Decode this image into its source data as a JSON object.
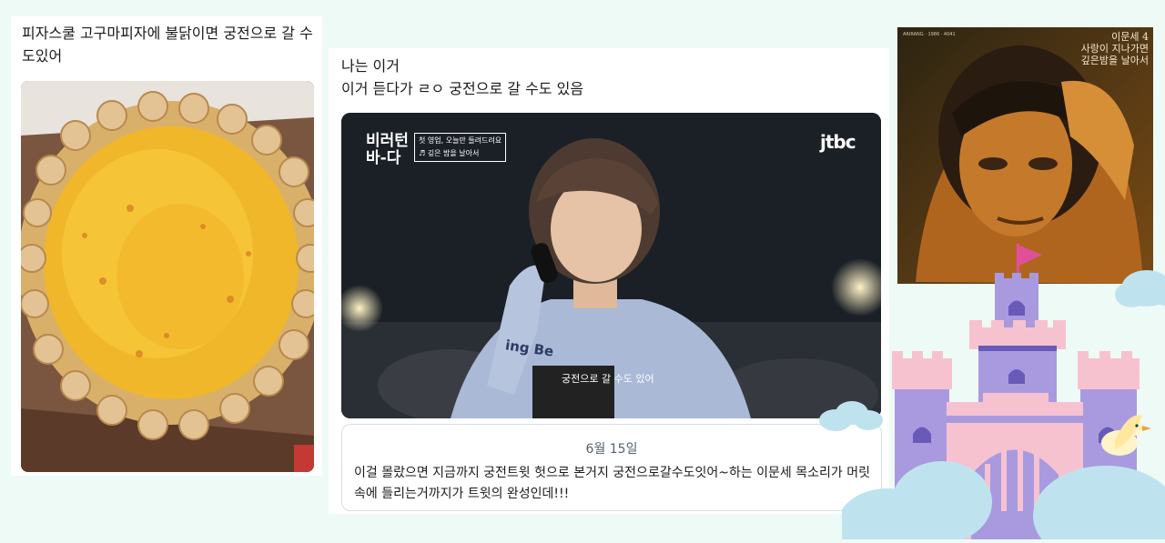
{
  "posts": {
    "left": {
      "text": "피자스쿨 고구마피자에 불닭이면 궁전으로 갈 수도있어",
      "image_icon": "pizza-photo"
    },
    "middle": {
      "line1": "나는 이거",
      "line2": "이거 듣다가 ㄹㅇ 궁전으로 갈 수도 있음",
      "video": {
        "show_logo": "비러턴 바-다",
        "caption_line1": "첫 영업, 오늘만 들려드려요",
        "caption_line2": "♬ 깊은 밤을 날아서",
        "broadcaster": "jtbc",
        "shirt_text": "ing Be",
        "subtitle": "궁전으로 갈 수도 있어"
      },
      "quote": {
        "date": "6월 15일",
        "text": "이걸 몰랐으면 지금까지 궁전트윗 헛으로 본거지 궁전으로갈수도잇어~하는 이문세 목소리가 머릿속에 들리는거까지가 트윗의 완성인데!!!"
      }
    }
  },
  "album": {
    "artist": "이문세 4",
    "track1": "사랑이 지나가면",
    "track2": "깊은밤을 날아서",
    "tiny_label": "ARIRANG · 1986 · 4041"
  },
  "colors": {
    "page_bg": "#eefaf5",
    "castle_wall": "#f7c2cf",
    "castle_purple": "#a99ae0",
    "cloud": "#bfe3ee",
    "flag": "#e0509a"
  }
}
